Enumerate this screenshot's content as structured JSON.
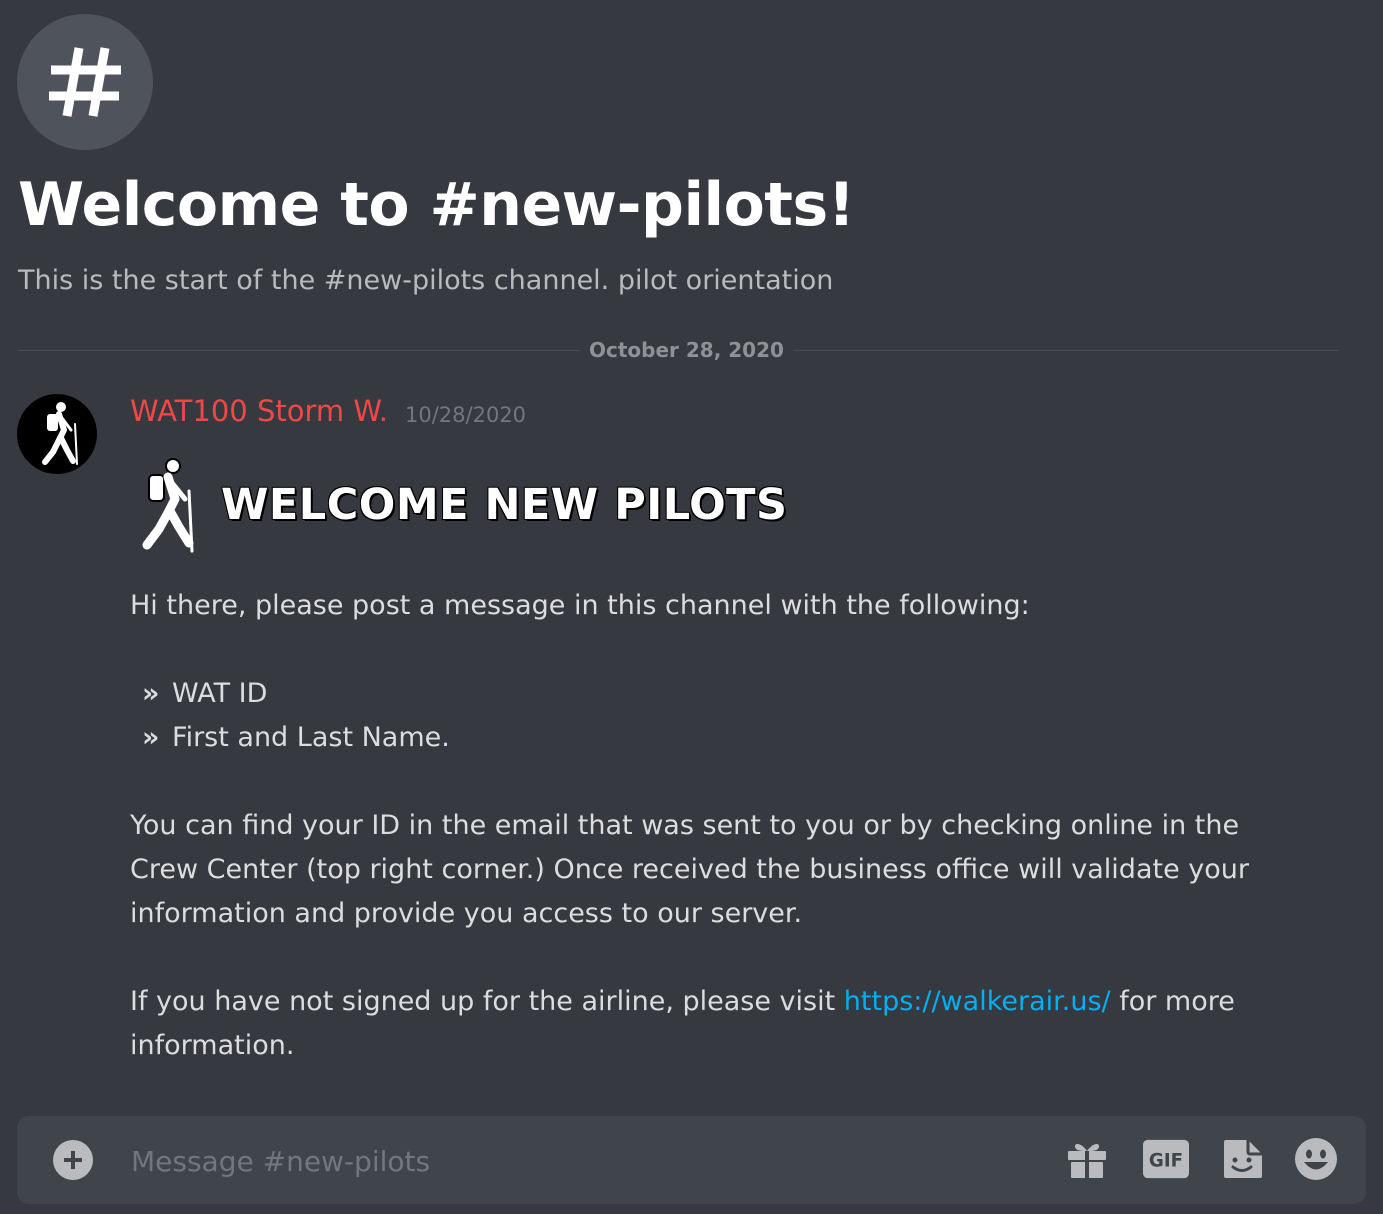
{
  "channel": {
    "icon": "hashtag-icon",
    "welcome_title": "Welcome to #new-pilots!",
    "welcome_subtitle": "This is the start of the #new-pilots channel. pilot orientation"
  },
  "date_divider": "October 28, 2020",
  "message": {
    "author": "WAT100 Storm W.",
    "author_color": "#f04747",
    "timestamp": "10/28/2020",
    "banner_text": "WELCOME NEW PILOTS",
    "intro": "Hi there, please post a message in this channel with the following:",
    "bullet_symbol": "»",
    "bullets": [
      "WAT ID",
      "First and Last Name."
    ],
    "para1_line1": "You can find your ID in the email that was sent to you or by checking online in the",
    "para1_line2": "Crew Center (top right corner.) Once received the business office will validate your",
    "para1_line3": "information and provide you access to our server.",
    "para2_prefix": "If you have not signed up for the airline, please visit ",
    "link": "https://walkerair.us/",
    "para2_suffix": " for more",
    "para2_line2": "information.",
    "link_color": "#00b0f4"
  },
  "composer": {
    "placeholder": "Message #new-pilots",
    "tools": [
      "plus-icon",
      "gift-icon",
      "gif-icon",
      "sticker-icon",
      "emoji-icon"
    ],
    "gif_label": "GIF"
  }
}
